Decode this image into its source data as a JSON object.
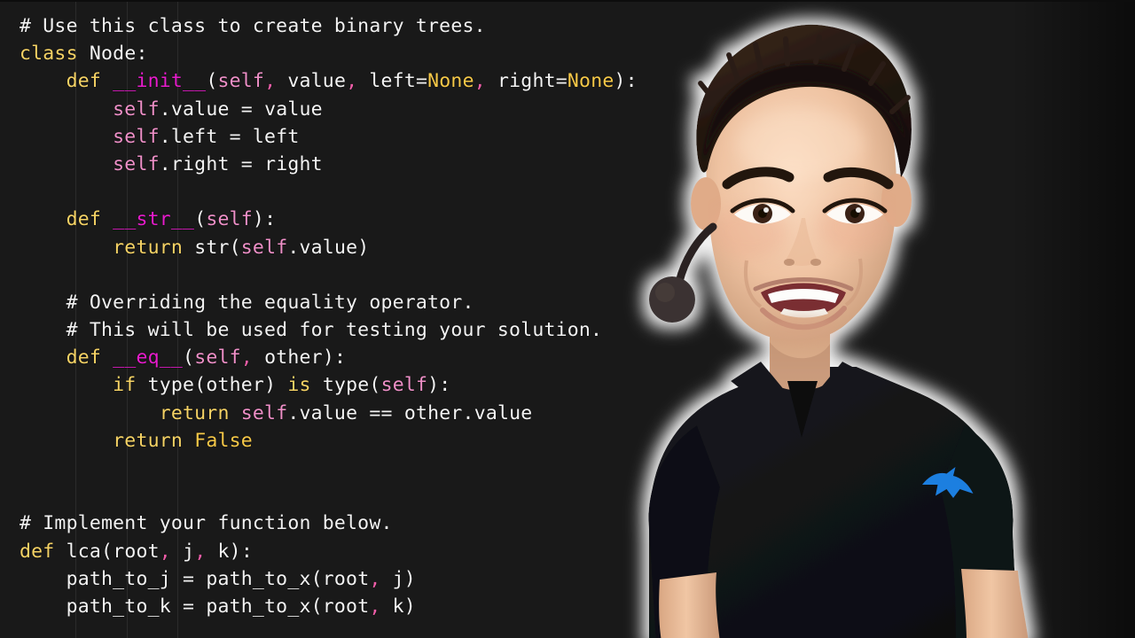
{
  "editor": {
    "language": "Python",
    "background_color": "#191919",
    "theme_colors": {
      "comment": "#f2f2f2",
      "keyword": "#f6d365",
      "function": "#e81ccd",
      "self": "#ef90c8",
      "constant": "#f7c948",
      "plain": "#f4f4f4",
      "comma": "#ee5ea8",
      "indent_guide": "#2b2b2b"
    },
    "lines": [
      {
        "n": 1,
        "tokens": [
          {
            "t": "# Use this class to create binary trees.",
            "c": "c-com"
          }
        ]
      },
      {
        "n": 2,
        "tokens": [
          {
            "t": "class",
            "c": "c-kw"
          },
          {
            "t": " ",
            "c": "c-plain"
          },
          {
            "t": "Node",
            "c": "c-name"
          },
          {
            "t": ":",
            "c": "c-punc"
          }
        ]
      },
      {
        "n": 3,
        "tokens": [
          {
            "t": "    ",
            "c": "c-plain"
          },
          {
            "t": "def",
            "c": "c-kw"
          },
          {
            "t": " ",
            "c": "c-plain"
          },
          {
            "t": "__init__",
            "c": "c-fn"
          },
          {
            "t": "(",
            "c": "c-punc"
          },
          {
            "t": "self",
            "c": "c-self"
          },
          {
            "t": ",",
            "c": "c-comma"
          },
          {
            "t": " value",
            "c": "c-name"
          },
          {
            "t": ",",
            "c": "c-comma"
          },
          {
            "t": " left",
            "c": "c-name"
          },
          {
            "t": "=",
            "c": "c-punc"
          },
          {
            "t": "None",
            "c": "c-const"
          },
          {
            "t": ",",
            "c": "c-comma"
          },
          {
            "t": " right",
            "c": "c-name"
          },
          {
            "t": "=",
            "c": "c-punc"
          },
          {
            "t": "None",
            "c": "c-const"
          },
          {
            "t": "):",
            "c": "c-punc"
          }
        ]
      },
      {
        "n": 4,
        "tokens": [
          {
            "t": "        ",
            "c": "c-plain"
          },
          {
            "t": "self",
            "c": "c-self"
          },
          {
            "t": ".",
            "c": "c-punc"
          },
          {
            "t": "value",
            "c": "c-name"
          },
          {
            "t": " = ",
            "c": "c-punc"
          },
          {
            "t": "value",
            "c": "c-name"
          }
        ]
      },
      {
        "n": 5,
        "tokens": [
          {
            "t": "        ",
            "c": "c-plain"
          },
          {
            "t": "self",
            "c": "c-self"
          },
          {
            "t": ".",
            "c": "c-punc"
          },
          {
            "t": "left",
            "c": "c-name"
          },
          {
            "t": " = ",
            "c": "c-punc"
          },
          {
            "t": "left",
            "c": "c-name"
          }
        ]
      },
      {
        "n": 6,
        "tokens": [
          {
            "t": "        ",
            "c": "c-plain"
          },
          {
            "t": "self",
            "c": "c-self"
          },
          {
            "t": ".",
            "c": "c-punc"
          },
          {
            "t": "right",
            "c": "c-name"
          },
          {
            "t": " = ",
            "c": "c-punc"
          },
          {
            "t": "right",
            "c": "c-name"
          }
        ]
      },
      {
        "n": 7,
        "tokens": []
      },
      {
        "n": 8,
        "tokens": [
          {
            "t": "    ",
            "c": "c-plain"
          },
          {
            "t": "def",
            "c": "c-kw"
          },
          {
            "t": " ",
            "c": "c-plain"
          },
          {
            "t": "__str__",
            "c": "c-fn"
          },
          {
            "t": "(",
            "c": "c-punc"
          },
          {
            "t": "self",
            "c": "c-self"
          },
          {
            "t": "):",
            "c": "c-punc"
          }
        ]
      },
      {
        "n": 9,
        "tokens": [
          {
            "t": "        ",
            "c": "c-plain"
          },
          {
            "t": "return",
            "c": "c-kw"
          },
          {
            "t": " ",
            "c": "c-plain"
          },
          {
            "t": "str",
            "c": "c-name"
          },
          {
            "t": "(",
            "c": "c-punc"
          },
          {
            "t": "self",
            "c": "c-self"
          },
          {
            "t": ".",
            "c": "c-punc"
          },
          {
            "t": "value",
            "c": "c-name"
          },
          {
            "t": ")",
            "c": "c-punc"
          }
        ]
      },
      {
        "n": 10,
        "tokens": []
      },
      {
        "n": 11,
        "tokens": [
          {
            "t": "    # Overriding the equality operator.",
            "c": "c-com"
          }
        ]
      },
      {
        "n": 12,
        "tokens": [
          {
            "t": "    # This will be used for testing your solution.",
            "c": "c-com"
          }
        ]
      },
      {
        "n": 13,
        "tokens": [
          {
            "t": "    ",
            "c": "c-plain"
          },
          {
            "t": "def",
            "c": "c-kw"
          },
          {
            "t": " ",
            "c": "c-plain"
          },
          {
            "t": "__eq__",
            "c": "c-fn"
          },
          {
            "t": "(",
            "c": "c-punc"
          },
          {
            "t": "self",
            "c": "c-self"
          },
          {
            "t": ",",
            "c": "c-comma"
          },
          {
            "t": " other",
            "c": "c-name"
          },
          {
            "t": "):",
            "c": "c-punc"
          }
        ]
      },
      {
        "n": 14,
        "tokens": [
          {
            "t": "        ",
            "c": "c-plain"
          },
          {
            "t": "if",
            "c": "c-kw"
          },
          {
            "t": " ",
            "c": "c-plain"
          },
          {
            "t": "type",
            "c": "c-name"
          },
          {
            "t": "(",
            "c": "c-punc"
          },
          {
            "t": "other",
            "c": "c-name"
          },
          {
            "t": ") ",
            "c": "c-punc"
          },
          {
            "t": "is",
            "c": "c-kw"
          },
          {
            "t": " ",
            "c": "c-plain"
          },
          {
            "t": "type",
            "c": "c-name"
          },
          {
            "t": "(",
            "c": "c-punc"
          },
          {
            "t": "self",
            "c": "c-self"
          },
          {
            "t": "):",
            "c": "c-punc"
          }
        ]
      },
      {
        "n": 15,
        "tokens": [
          {
            "t": "            ",
            "c": "c-plain"
          },
          {
            "t": "return",
            "c": "c-kw"
          },
          {
            "t": " ",
            "c": "c-plain"
          },
          {
            "t": "self",
            "c": "c-self"
          },
          {
            "t": ".",
            "c": "c-punc"
          },
          {
            "t": "value",
            "c": "c-name"
          },
          {
            "t": " == ",
            "c": "c-op"
          },
          {
            "t": "other",
            "c": "c-name"
          },
          {
            "t": ".",
            "c": "c-punc"
          },
          {
            "t": "value",
            "c": "c-name"
          }
        ]
      },
      {
        "n": 16,
        "tokens": [
          {
            "t": "        ",
            "c": "c-plain"
          },
          {
            "t": "return",
            "c": "c-kw"
          },
          {
            "t": " ",
            "c": "c-plain"
          },
          {
            "t": "False",
            "c": "c-const"
          }
        ]
      },
      {
        "n": 17,
        "tokens": []
      },
      {
        "n": 18,
        "tokens": []
      },
      {
        "n": 19,
        "tokens": [
          {
            "t": "# Implement your function below.",
            "c": "c-com"
          }
        ]
      },
      {
        "n": 20,
        "tokens": [
          {
            "t": "def",
            "c": "c-kw"
          },
          {
            "t": " ",
            "c": "c-plain"
          },
          {
            "t": "lca",
            "c": "c-name"
          },
          {
            "t": "(",
            "c": "c-punc"
          },
          {
            "t": "root",
            "c": "c-name"
          },
          {
            "t": ",",
            "c": "c-comma"
          },
          {
            "t": " j",
            "c": "c-name"
          },
          {
            "t": ",",
            "c": "c-comma"
          },
          {
            "t": " k",
            "c": "c-name"
          },
          {
            "t": "):",
            "c": "c-punc"
          }
        ]
      },
      {
        "n": 21,
        "tokens": [
          {
            "t": "    ",
            "c": "c-plain"
          },
          {
            "t": "path_to_j",
            "c": "c-name"
          },
          {
            "t": " = ",
            "c": "c-punc"
          },
          {
            "t": "path_to_x",
            "c": "c-name"
          },
          {
            "t": "(",
            "c": "c-punc"
          },
          {
            "t": "root",
            "c": "c-name"
          },
          {
            "t": ",",
            "c": "c-comma"
          },
          {
            "t": " j",
            "c": "c-name"
          },
          {
            "t": ")",
            "c": "c-punc"
          }
        ]
      },
      {
        "n": 22,
        "tokens": [
          {
            "t": "    ",
            "c": "c-plain"
          },
          {
            "t": "path_to_k",
            "c": "c-name"
          },
          {
            "t": " = ",
            "c": "c-punc"
          },
          {
            "t": "path_to_x",
            "c": "c-name"
          },
          {
            "t": "(",
            "c": "c-punc"
          },
          {
            "t": "root",
            "c": "c-name"
          },
          {
            "t": ",",
            "c": "c-comma"
          },
          {
            "t": " k",
            "c": "c-name"
          },
          {
            "t": ")",
            "c": "c-punc"
          }
        ]
      }
    ],
    "plain_text": "# Use this class to create binary trees.\nclass Node:\n    def __init__(self, value, left=None, right=None):\n        self.value = value\n        self.left = left\n        self.right = right\n\n    def __str__(self):\n        return str(self.value)\n\n    # Overriding the equality operator.\n    # This will be used for testing your solution.\n    def __eq__(self, other):\n        if type(other) is type(self):\n            return self.value == other.value\n        return False\n\n\n# Implement your function below.\ndef lca(root, j, k):\n    path_to_j = path_to_x(root, j)\n    path_to_k = path_to_x(root, k)"
  },
  "presenter": {
    "description": "Smiling young man with headset microphone, black polo shirt, white glow outline",
    "shirt_color": "#15161b",
    "shirt_logo": "eagle-logo",
    "shirt_logo_color": "#1f7fe0",
    "skin_color": "#f0c5a6",
    "hair_color": "#2a1c14",
    "glow_color": "#ffffff",
    "mic": "headset-boom-mic",
    "mic_color": "#3b3230"
  }
}
